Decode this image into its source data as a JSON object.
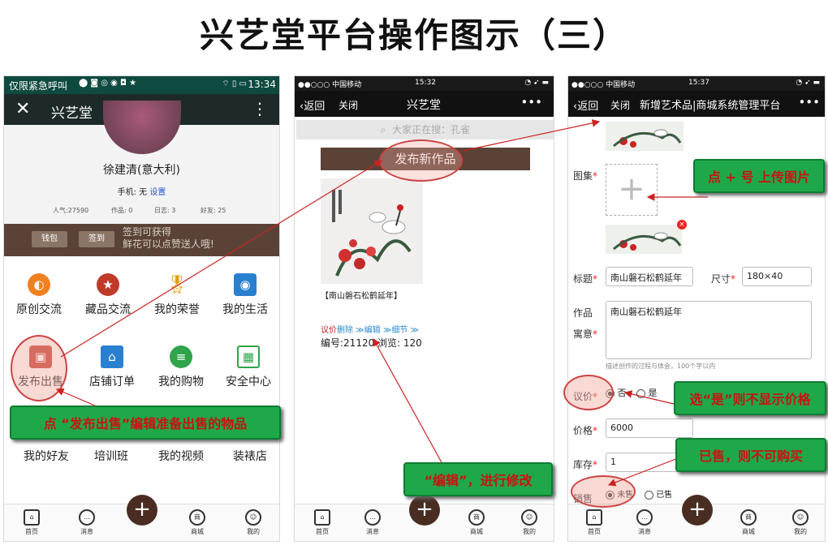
{
  "title": "兴艺堂平台操作图示（三）",
  "phone1": {
    "status_left": "仅限紧急呼叫",
    "status_time": "13:34",
    "nav_title": "兴艺堂",
    "name": "徐建清(意大利)",
    "phone_label": "手机: 无",
    "phone_link": "设置",
    "stats": [
      "人气:27590",
      "作品: 0",
      "日志: 3",
      "好友: 25"
    ],
    "wallet": "钱包",
    "signin": "签到",
    "promo_line1": "签到可获得",
    "promo_line2": "鲜花可以点赞送人哦!",
    "grid_row1": [
      "原创交流",
      "藏品交流",
      "我的荣誉",
      "我的生活"
    ],
    "grid_row2": [
      "发布出售",
      "店铺订单",
      "我的购物",
      "安全中心"
    ],
    "grid_row4": [
      "我的好友",
      "培训班",
      "我的视频",
      "装裱店"
    ],
    "tabs": [
      "首页",
      "消息",
      "",
      "商城",
      "我的"
    ]
  },
  "phone2": {
    "status_left": "●●○○○ 中国移动",
    "status_time": "15:32",
    "back": "返回",
    "close": "关闭",
    "nav_title": "兴艺堂",
    "search_placeholder": "大家正在搜：孔雀",
    "publish_button": "发布新作品",
    "artwork_title": "【南山磐石松鹤延年】",
    "action_price": "议价",
    "action_delete": "删除",
    "action_edit": "编辑",
    "action_detail": "细节",
    "artwork_meta": "编号:21120 浏览: 120",
    "tabs": [
      "首页",
      "消息",
      "",
      "商城",
      "我的"
    ]
  },
  "phone3": {
    "status_left": "●●○○○ 中国移动",
    "status_time": "15:37",
    "back": "返回",
    "close": "关闭",
    "nav_title": "新增艺术品|商城系统管理平台",
    "gallery_label": "图集",
    "title_label": "标题",
    "title_value": "南山磐石松鹤延年",
    "size_label": "尺寸",
    "size_value": "180×40",
    "meaning_label1": "作品",
    "meaning_label2": "寓意",
    "meaning_value": "南山磐石松鹤延年",
    "meaning_hint": "描述创作的过程与体会，100个字以内",
    "negotiable_label": "议价",
    "opt_no": "否",
    "opt_yes": "是",
    "price_label": "价格",
    "price_value": "6000",
    "stock_label": "库存",
    "stock_value": "1",
    "sales_label": "销售",
    "opt_unsold": "未售",
    "opt_sold": "已售",
    "tabs": [
      "首页",
      "消息",
      "",
      "商城",
      "我的"
    ]
  },
  "callouts": {
    "publish_sale": "点 “发布出售”编辑准备出售的物品",
    "edit": "“编辑”，进行修改",
    "upload": "点 + 号 上传图片",
    "yes_no_price": "选“是”则不显示价格",
    "sold": "已售，则不可购买"
  },
  "colors": {
    "accent_green": "#1ea84a",
    "callout_text": "#cc1111",
    "brown": "#5a4336",
    "statusbar": "#0f4a40"
  }
}
